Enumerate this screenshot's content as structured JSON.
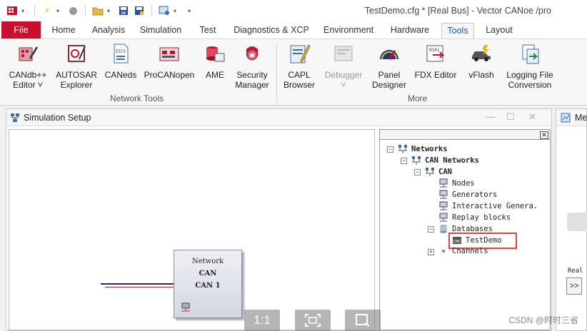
{
  "window": {
    "title": "TestDemo.cfg * [Real Bus] - Vector CANoe /pro"
  },
  "tabs": [
    "File",
    "Home",
    "Analysis",
    "Simulation",
    "Test",
    "Diagnostics & XCP",
    "Environment",
    "Hardware",
    "Tools",
    "Layout"
  ],
  "active_tab": "Tools",
  "ribbon": {
    "network_tools": {
      "label": "Network Tools",
      "buttons": [
        {
          "label1": "CANdb++",
          "label2": "Editor ˅"
        },
        {
          "label1": "AUTOSAR",
          "label2": "Explorer"
        },
        {
          "label1": "CANeds",
          "label2": ""
        },
        {
          "label1": "ProCANopen",
          "label2": ""
        },
        {
          "label1": "AME",
          "label2": ""
        },
        {
          "label1": "Security",
          "label2": "Manager"
        }
      ]
    },
    "more": {
      "label": "More",
      "buttons": [
        {
          "label1": "CAPL",
          "label2": "Browser"
        },
        {
          "label1": "Debugger",
          "label2": "˅"
        },
        {
          "label1": "Panel",
          "label2": "Designer"
        },
        {
          "label1": "FDX Editor",
          "label2": ""
        },
        {
          "label1": "vFlash",
          "label2": ""
        },
        {
          "label1": "Logging File",
          "label2": "Conversion"
        }
      ]
    }
  },
  "sim_window": {
    "title": "Simulation Setup",
    "network_block": {
      "line1": "Network",
      "line2": "CAN",
      "line3": "CAN 1"
    },
    "zoom_label": "1:1"
  },
  "tree": {
    "networks": "Networks",
    "can_networks": "CAN Networks",
    "can": "CAN",
    "nodes": "Nodes",
    "generators": "Generators",
    "interactive": "Interactive Genera.",
    "replay": "Replay blocks",
    "databases": "Databases",
    "testdemo": "TestDemo",
    "channels": "Channels"
  },
  "right_window": {
    "title": "Me",
    "label": "Real",
    "button": ">>"
  },
  "watermark": "CSDN @时时三省",
  "colors": {
    "file_tab": "#c8102e",
    "highlight": "#e0443e",
    "active_tab_text": "#1a5fb4"
  }
}
